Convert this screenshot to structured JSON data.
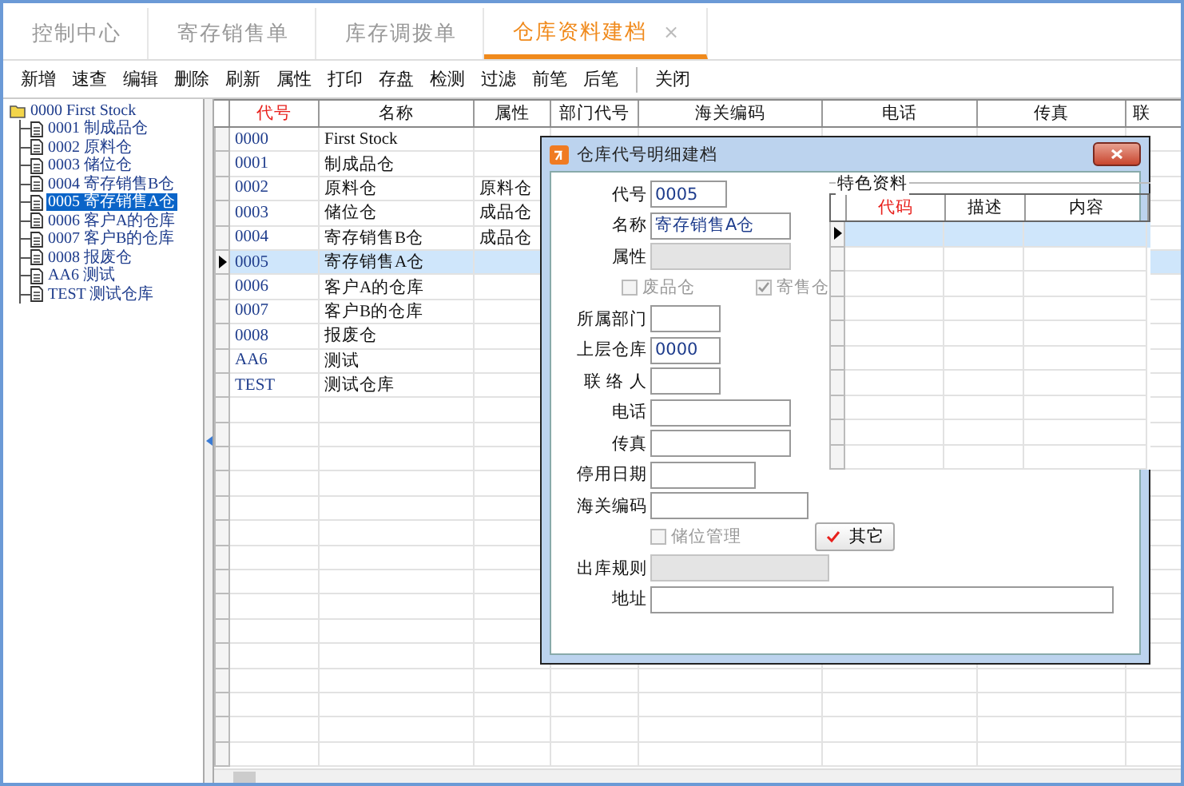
{
  "tabs": [
    {
      "label": "控制中心",
      "selected": false
    },
    {
      "label": "寄存销售单",
      "selected": false
    },
    {
      "label": "库存调拨单",
      "selected": false
    },
    {
      "label": "仓库资料建档",
      "selected": true,
      "close": "×"
    }
  ],
  "toolbar": {
    "items": [
      "新增",
      "速查",
      "编辑",
      "删除",
      "刷新",
      "属性",
      "打印",
      "存盘",
      "检测",
      "过滤",
      "前笔",
      "后笔"
    ],
    "trailing": [
      "关闭"
    ]
  },
  "tree": {
    "label": "0000 First Stock",
    "expanded": true,
    "children": [
      {
        "label": "0001 制成品仓",
        "selected": false
      },
      {
        "label": "0002 原料仓",
        "selected": false
      },
      {
        "label": "0003 储位仓",
        "selected": false
      },
      {
        "label": "0004 寄存销售B仓",
        "selected": false
      },
      {
        "label": "0005 寄存销售A仓",
        "selected": true
      },
      {
        "label": "0006 客户A的仓库",
        "selected": false
      },
      {
        "label": "0007 客户B的仓库",
        "selected": false
      },
      {
        "label": "0008 报废仓",
        "selected": false
      },
      {
        "label": "AA6 测试",
        "selected": false
      },
      {
        "label": "TEST 测试仓库",
        "selected": false
      }
    ]
  },
  "grid": {
    "columns": [
      {
        "label": "代号",
        "required": true
      },
      {
        "label": "名称",
        "required": false
      },
      {
        "label": "属性",
        "required": false
      },
      {
        "label": "部门代号",
        "required": false
      },
      {
        "label": "海关编码",
        "required": false
      },
      {
        "label": "电话",
        "required": false
      },
      {
        "label": "传真",
        "required": false
      },
      {
        "label": "联",
        "required": false
      }
    ],
    "rows": [
      {
        "cells": [
          "0000",
          "First Stock"
        ],
        "selected": false
      },
      {
        "cells": [
          "0001",
          "制成品仓"
        ],
        "selected": false
      },
      {
        "cells": [
          "0002",
          "原料仓",
          "原料仓"
        ],
        "selected": false
      },
      {
        "cells": [
          "0003",
          "储位仓",
          "成品仓"
        ],
        "selected": false
      },
      {
        "cells": [
          "0004",
          "寄存销售B仓",
          "成品仓"
        ],
        "selected": false
      },
      {
        "cells": [
          "0005",
          "寄存销售A仓"
        ],
        "selected": true
      },
      {
        "cells": [
          "0006",
          "客户A的仓库"
        ],
        "selected": false
      },
      {
        "cells": [
          "0007",
          "客户B的仓库"
        ],
        "selected": false
      },
      {
        "cells": [
          "0008",
          "报废仓"
        ],
        "selected": false
      },
      {
        "cells": [
          "AA6",
          "测试"
        ],
        "selected": false
      },
      {
        "cells": [
          "TEST",
          "测试仓库"
        ],
        "selected": false
      }
    ]
  },
  "dialog": {
    "title": "仓库代号明细建档",
    "form_left": [
      {
        "kind": "field",
        "label": "代号",
        "value": "0005",
        "disabled": false
      },
      {
        "kind": "field",
        "label": "名称",
        "value": "寄存销售A仓",
        "disabled": false
      },
      {
        "kind": "field",
        "label": "属性",
        "disabled": true
      },
      {
        "kind": "checks",
        "items": [
          {
            "label": "废品仓",
            "checked": false,
            "disabled": true
          },
          {
            "label": "寄售仓",
            "checked": true,
            "disabled": true
          }
        ]
      },
      {
        "kind": "field",
        "label": "所属部门",
        "disabled": false
      },
      {
        "kind": "field",
        "label": "上层仓库",
        "value": "0000",
        "disabled": false
      },
      {
        "kind": "field",
        "label": "联 络 人",
        "disabled": false
      },
      {
        "kind": "field",
        "label": "电话",
        "disabled": false
      },
      {
        "kind": "field",
        "label": "传真",
        "disabled": false
      },
      {
        "kind": "field",
        "label": "停用日期",
        "disabled": false
      },
      {
        "kind": "field",
        "label": "海关编码",
        "disabled": false
      }
    ],
    "form_bottom": [
      {
        "kind": "checkbutton",
        "check": {
          "label": "储位管理",
          "checked": false,
          "disabled": true
        },
        "button": "其它"
      },
      {
        "kind": "field",
        "label": "出库规则",
        "disabled": true
      },
      {
        "kind": "field",
        "label": "地址",
        "disabled": false
      }
    ],
    "feature_panel": {
      "title": "特色资料",
      "columns": [
        {
          "label": "代码",
          "required": true
        },
        {
          "label": "描述",
          "required": false
        },
        {
          "label": "内容",
          "required": false
        }
      ],
      "rows": [
        {
          "selected": true
        },
        {
          "selected": false
        },
        {
          "selected": false
        },
        {
          "selected": false
        },
        {
          "selected": false
        },
        {
          "selected": false
        },
        {
          "selected": false
        },
        {
          "selected": false
        },
        {
          "selected": false
        },
        {
          "selected": false
        }
      ]
    }
  }
}
